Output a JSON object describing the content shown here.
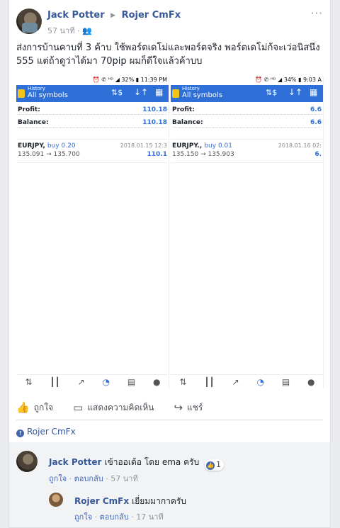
{
  "post": {
    "author": "Jack Potter",
    "page": "Rojer CmFx",
    "time": "57 นาที · ",
    "privacy_icon": "friends-icon",
    "text": "ส่งการบ้านคาบที่ 3 ค้าบ ใช้พอร์ตเดโม่และพอร์ตจริง พอร์ตเดโม่ก้จะเว่อนิสนึง 555 แต่ถ้าดูว่าได้มา 70pip ผมก็ดีใจแล้วค้าบบ",
    "screens": [
      {
        "status": "⏰ ✆ ᴴᴰ ◢ 32% ▮ 11:39 PM",
        "history": "History",
        "symbols": "All symbols",
        "profit_label": "Profit:",
        "profit_value": "110.18",
        "balance_label": "Balance:",
        "balance_value": "110.18",
        "trade_symbol": "EURJPY",
        "trade_side": "buy 0.20",
        "trade_prices": "135.091 → 135.700",
        "trade_date": "2018.01.15 12:3",
        "trade_profit": "110.1"
      },
      {
        "status": "⏰ ✆ ᴴᴰ ◢ 34% ▮ 9:03 A",
        "history": "History",
        "symbols": "All symbols",
        "profit_label": "Profit:",
        "profit_value": "6.6",
        "balance_label": "Balance:",
        "balance_value": "6.6",
        "trade_symbol": "EURJPY.",
        "trade_side": "buy 0.01",
        "trade_prices": "135.150 → 135.903",
        "trade_date": "2018.01.16 02:",
        "trade_profit": "6."
      }
    ],
    "actions": {
      "like": "ถูกใจ",
      "comment": "แสดงความคิดเห็น",
      "share": "แชร์"
    },
    "commenting_as": "Rojer CmFx"
  },
  "comments": [
    {
      "author": "Jack Potter",
      "text": "เข้าออเด้อ โดย ema ครับ",
      "reactions": "1",
      "like": "ถูกใจ",
      "reply": "ตอบกลับ",
      "time": "57 นาที"
    },
    {
      "author": "Rojer CmFx",
      "text": "เยี่ยมมากาครับ",
      "like": "ถูกใจ",
      "reply": "ตอบกลับ",
      "time": "17 นาที"
    }
  ],
  "colors": {
    "link": "#365899",
    "accent": "#4267b2",
    "app_bar": "#2e6fd8"
  }
}
